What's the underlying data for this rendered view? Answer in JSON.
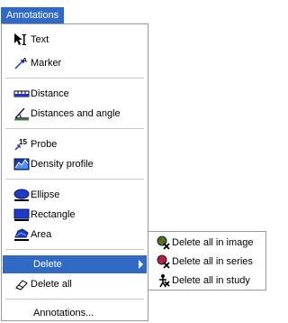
{
  "menu": {
    "title": "Annotations",
    "items": [
      {
        "label": "Text",
        "icon": "text-annotation-icon"
      },
      {
        "label": "Marker",
        "icon": "marker-icon"
      },
      {
        "label": "Distance",
        "icon": "ruler-icon"
      },
      {
        "label": "Distances and angle",
        "icon": "angle-icon"
      },
      {
        "label": "Probe",
        "icon": "probe-icon"
      },
      {
        "label": "Density profile",
        "icon": "density-profile-icon"
      },
      {
        "label": "Ellipse",
        "icon": "ellipse-icon"
      },
      {
        "label": "Rectangle",
        "icon": "rectangle-icon"
      },
      {
        "label": "Area",
        "icon": "area-icon"
      },
      {
        "label": "Delete",
        "icon": "",
        "selected": true,
        "has_submenu": true
      },
      {
        "label": "Delete all",
        "icon": "eraser-icon"
      },
      {
        "label": "Annotations...",
        "icon": ""
      }
    ],
    "probe_icon_text": "15"
  },
  "submenu": {
    "items": [
      {
        "label": "Delete all in image",
        "icon": "delete-image-icon"
      },
      {
        "label": "Delete all in series",
        "icon": "delete-series-icon"
      },
      {
        "label": "Delete all in study",
        "icon": "delete-study-icon"
      }
    ]
  },
  "colors": {
    "highlight": "#316ac5",
    "separator": "#c8c8c8",
    "border": "#9a9a9a"
  }
}
